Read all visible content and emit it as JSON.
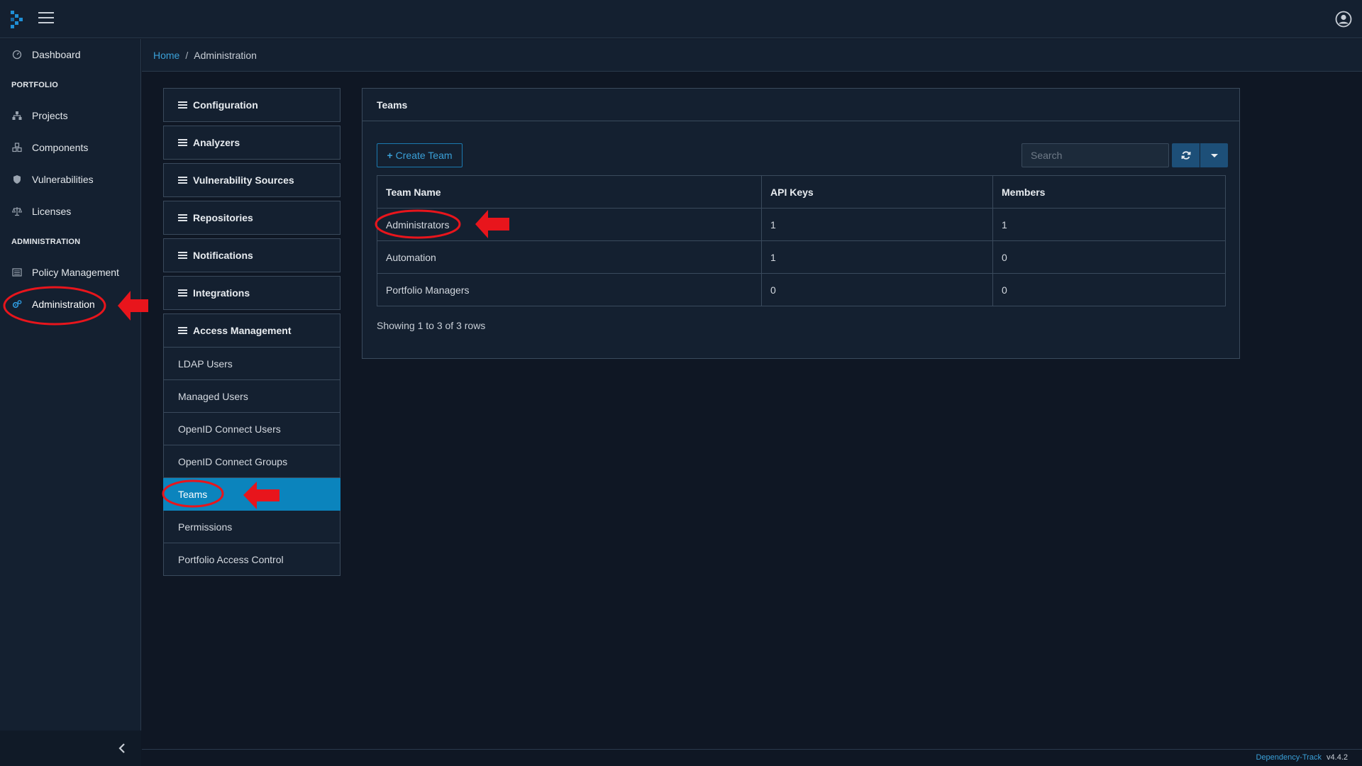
{
  "topbar": {
    "logo_icon": "dependency-track-logo",
    "menu_icon": "hamburger-icon",
    "user_icon": "user-circle-icon"
  },
  "sidebar": {
    "dashboard": "Dashboard",
    "portfolio_heading": "PORTFOLIO",
    "projects": "Projects",
    "components": "Components",
    "vulnerabilities": "Vulnerabilities",
    "licenses": "Licenses",
    "administration_heading": "ADMINISTRATION",
    "policy_management": "Policy Management",
    "administration": "Administration",
    "collapse_icon": "chevron-left-icon"
  },
  "breadcrumb": {
    "home": "Home",
    "separator": "/",
    "current": "Administration"
  },
  "admin_menu": {
    "sections": [
      "Configuration",
      "Analyzers",
      "Vulnerability Sources",
      "Repositories",
      "Notifications",
      "Integrations",
      "Access Management"
    ],
    "access_items": [
      "LDAP Users",
      "Managed Users",
      "OpenID Connect Users",
      "OpenID Connect Groups",
      "Teams",
      "Permissions",
      "Portfolio Access Control"
    ],
    "active_item": "Teams"
  },
  "teams_panel": {
    "title": "Teams",
    "create_button": "Create Team",
    "search_placeholder": "Search",
    "columns": [
      "Team Name",
      "API Keys",
      "Members"
    ],
    "rows": [
      {
        "name": "Administrators",
        "api_keys": "1",
        "members": "1"
      },
      {
        "name": "Automation",
        "api_keys": "1",
        "members": "0"
      },
      {
        "name": "Portfolio Managers",
        "api_keys": "0",
        "members": "0"
      }
    ],
    "showing": "Showing 1 to 3 of 3 rows"
  },
  "footer": {
    "brand": "Dependency-Track",
    "version": "v4.4.2"
  },
  "colors": {
    "background": "#0f1724",
    "panel": "#142030",
    "accent": "#0b84bd",
    "link": "#3aa0d8",
    "annotation": "#e8151c"
  }
}
